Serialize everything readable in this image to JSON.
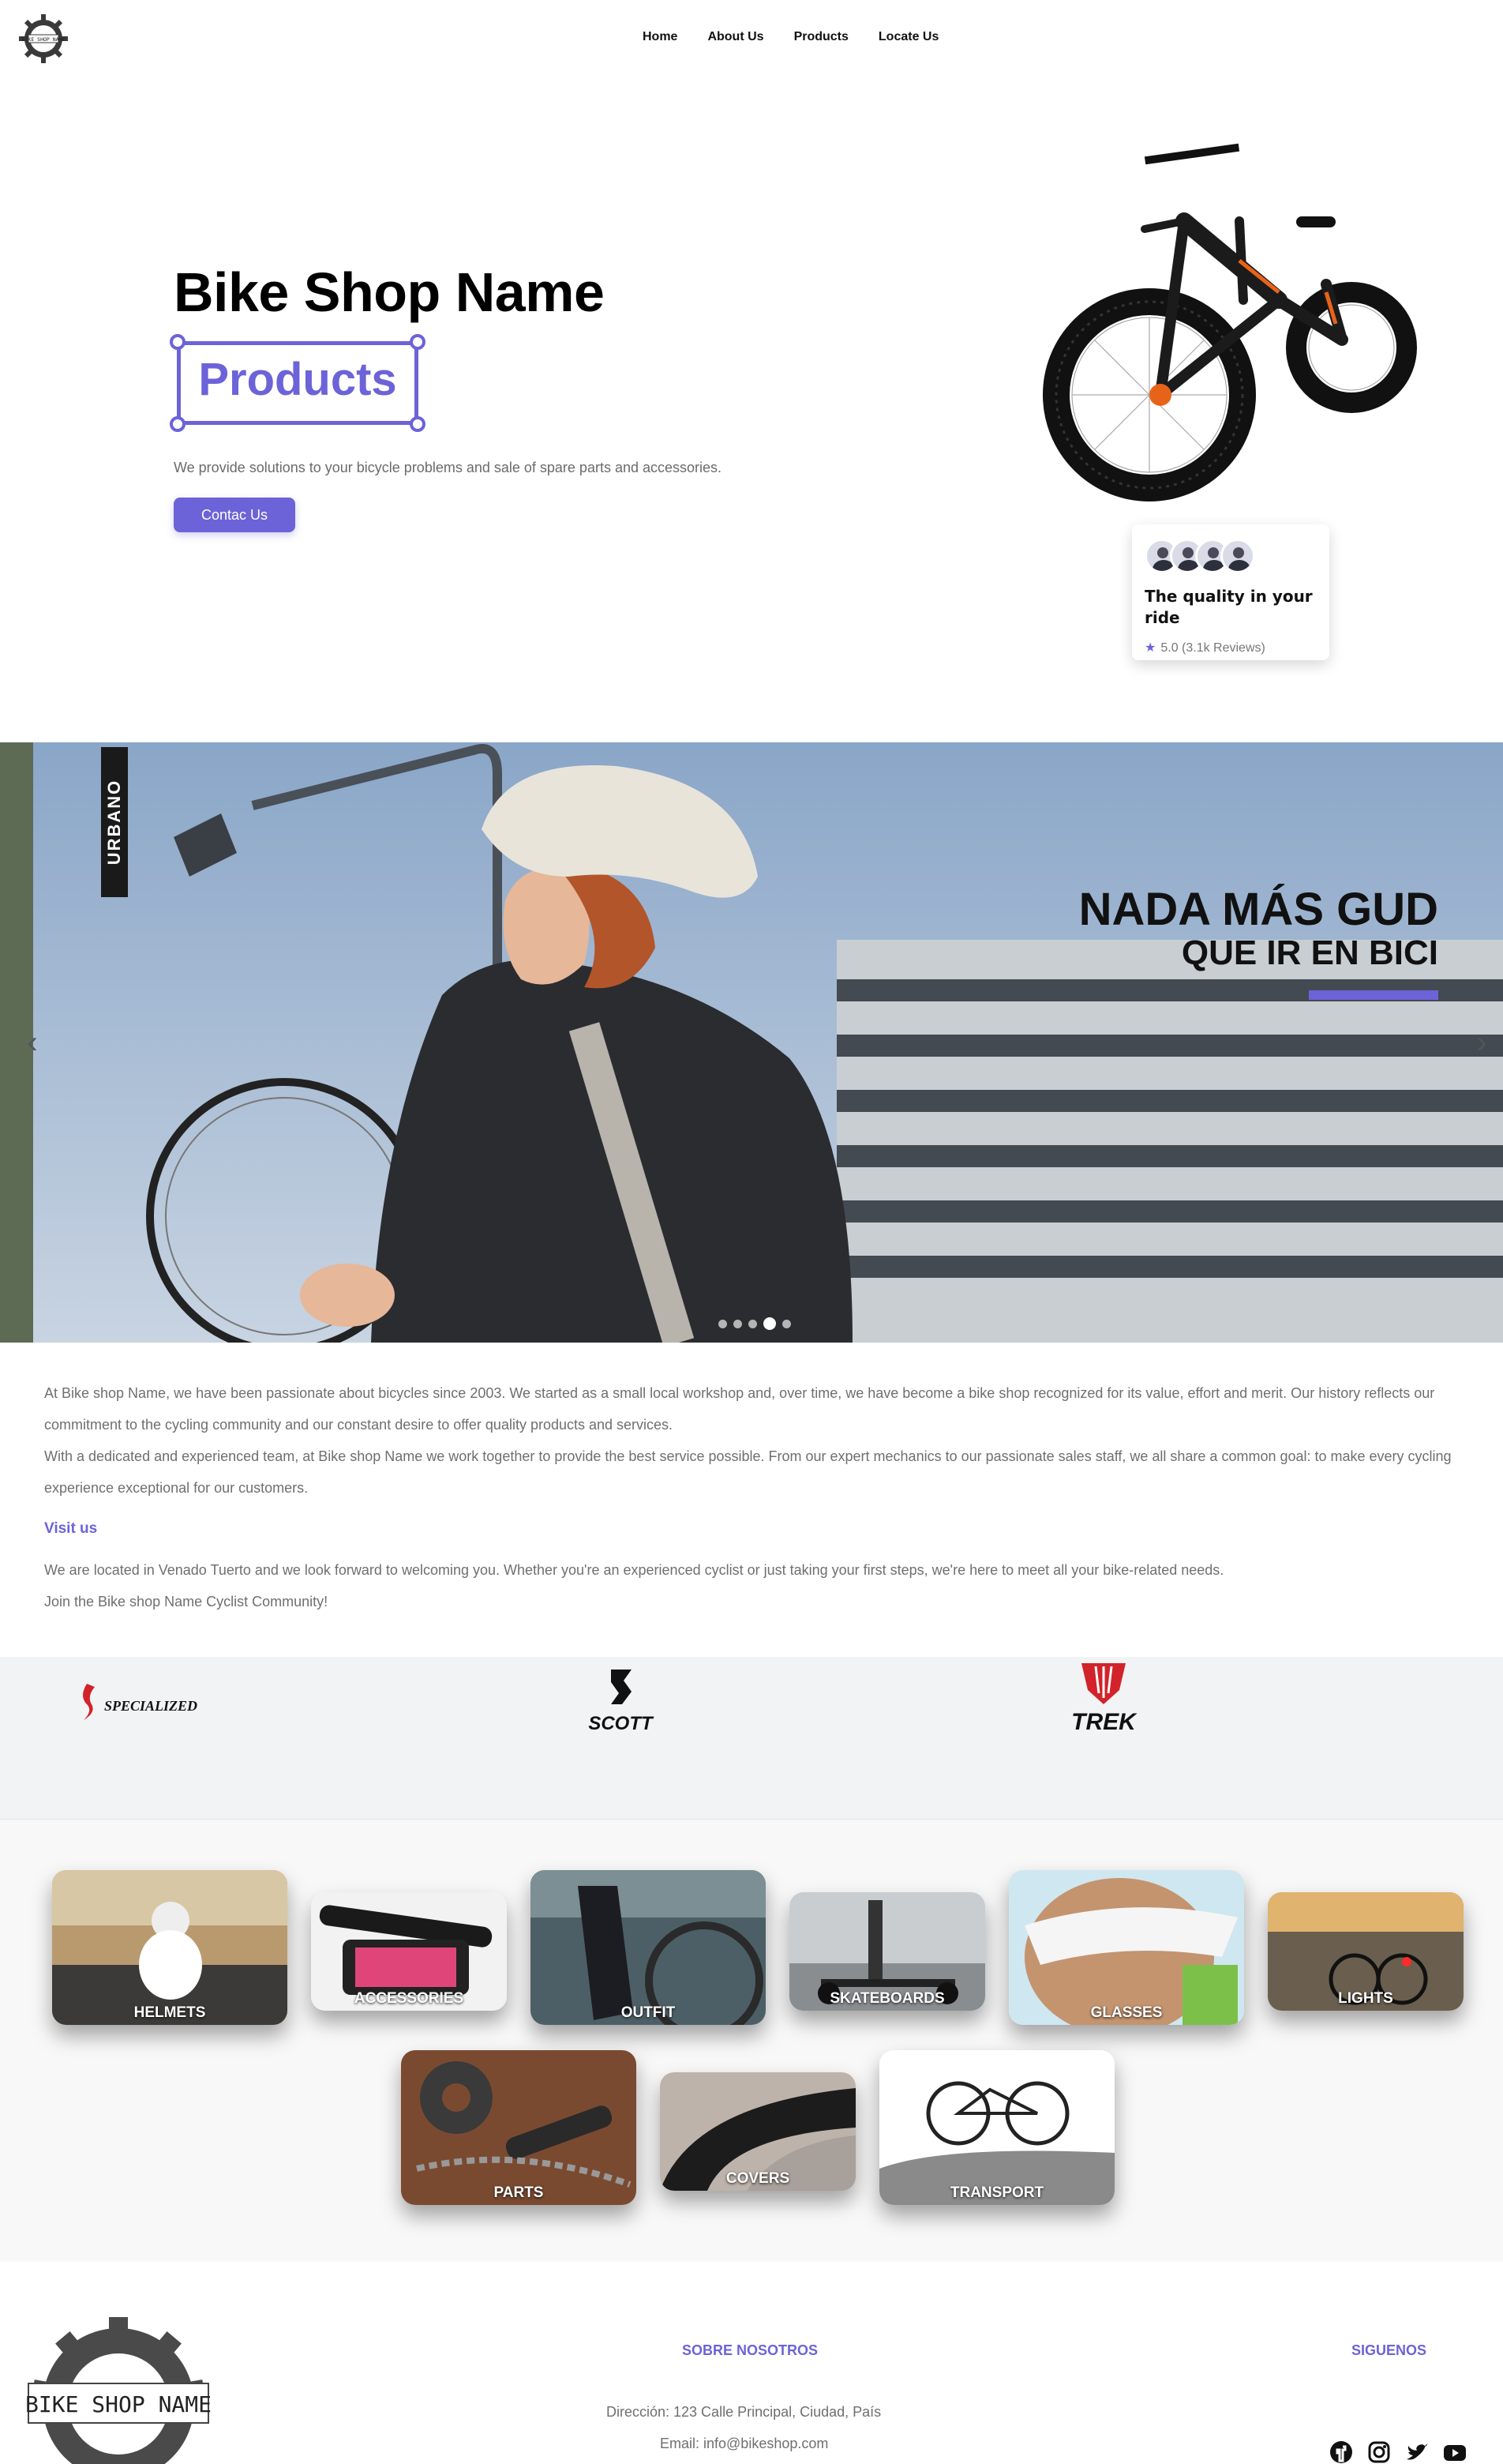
{
  "nav": {
    "logo_text": "BIKE SHOP NAME",
    "links": [
      "Home",
      "About Us",
      "Products",
      "Locate Us"
    ]
  },
  "hero": {
    "title": "Bike Shop Name",
    "highlight": "Products",
    "description": "We provide solutions to your bicycle problems and sale of spare parts and accessories.",
    "button": "Contac Us",
    "review": {
      "title": "The quality in your ride",
      "rating": "5.0 (3.1k Reviews)"
    }
  },
  "carousel": {
    "tag": "URBANO",
    "headline": "NADA MÁS GUD",
    "subheadline": "QUE IR EN BICI",
    "slides": 5,
    "active_slide": 4,
    "accent": "#6c63d8"
  },
  "about": {
    "p1": "At Bike shop Name, we have been passionate about bicycles since 2003. We started as a small local workshop and, over time, we have become a bike shop recognized for its value, effort and merit. Our history reflects our commitment to the cycling community and our constant desire to offer quality products and services.",
    "p2": "With a dedicated and experienced team, at Bike shop Name we work together to provide the best service possible. From our expert mechanics to our passionate sales staff, we all share a common goal: to make every cycling experience exceptional for our customers.",
    "visit_title": "Visit us",
    "p3": "We are located in Venado Tuerto and we look forward to welcoming you. Whether you're an experienced cyclist or just taking your first steps, we're here to meet all your bike-related needs.",
    "p4": "Join the Bike shop Name Cyclist Community!"
  },
  "brands": [
    "SPECIALIZED",
    "SCOTT",
    "TREK"
  ],
  "categories": [
    "HELMETS",
    "ACCESSORIES",
    "OUTFIT",
    "SKATEBOARDS",
    "GLASSES",
    "LIGHTS",
    "PARTS",
    "COVERS",
    "TRANSPORT"
  ],
  "footer": {
    "logo_text": "BIKE SHOP NAME",
    "about_title": "SOBRE NOSOTROS",
    "address": "Dirección: 123 Calle Principal, Ciudad, País",
    "email": "Email: info@bikeshop.com",
    "follow_title": "SIGUENOS",
    "social_icons": [
      "facebook-icon",
      "instagram-icon",
      "twitter-icon",
      "youtube-icon"
    ]
  }
}
